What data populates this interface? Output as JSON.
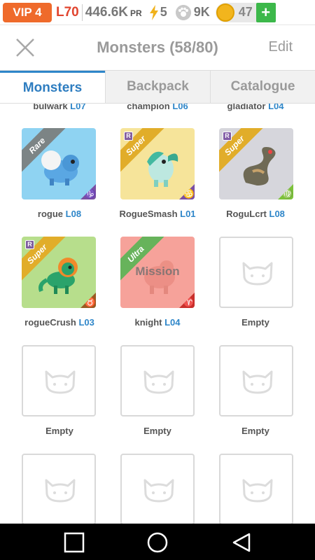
{
  "status": {
    "vip": "VIP 4",
    "level": "L70",
    "power_value": "446.6K",
    "power_unit": "PR",
    "energy": "5",
    "paw_amount": "9K",
    "gold": "47",
    "add_label": "+"
  },
  "header": {
    "title": "Monsters (58/80)",
    "edit_label": "Edit"
  },
  "tabs": [
    {
      "label": "Monsters",
      "active": true
    },
    {
      "label": "Backpack",
      "active": false
    },
    {
      "label": "Catalogue",
      "active": false
    }
  ],
  "cut_row": [
    {
      "name": "bulwark",
      "level": "L07"
    },
    {
      "name": "champion",
      "level": "L06"
    },
    {
      "name": "gladiator",
      "level": "L04"
    }
  ],
  "monsters": [
    {
      "name": "rogue",
      "level": "L08",
      "rarity": "Rare",
      "zodiac": "♑",
      "bg": "#8fd3f2",
      "zodiac_color": "#7a4fa3"
    },
    {
      "name": "RogueSmash",
      "level": "L01",
      "rarity": "Super",
      "zodiac": "♋",
      "bg": "#f6e49a",
      "zodiac_color": "#7a4fa3"
    },
    {
      "name": "RoguLcrt",
      "level": "L08",
      "rarity": "Super",
      "zodiac": "♍",
      "bg": "#d6d6dc",
      "zodiac_color": "#7cc23a"
    },
    {
      "name": "rogueCrush",
      "level": "L03",
      "rarity": "Super",
      "zodiac": "♉",
      "bg": "#b7de8c",
      "zodiac_color": "#9a5a22"
    },
    {
      "name": "knight",
      "level": "L04",
      "rarity": "Ultra",
      "zodiac": "♈",
      "bg": "#f6a29a",
      "zodiac_color": "#c9302c",
      "overlay": "Mission"
    }
  ],
  "empty_label": "Empty",
  "colors": {
    "accent": "#2e86c9",
    "vip": "#ef6a2b",
    "level": "#e1452f",
    "plus": "#3cb84a"
  }
}
